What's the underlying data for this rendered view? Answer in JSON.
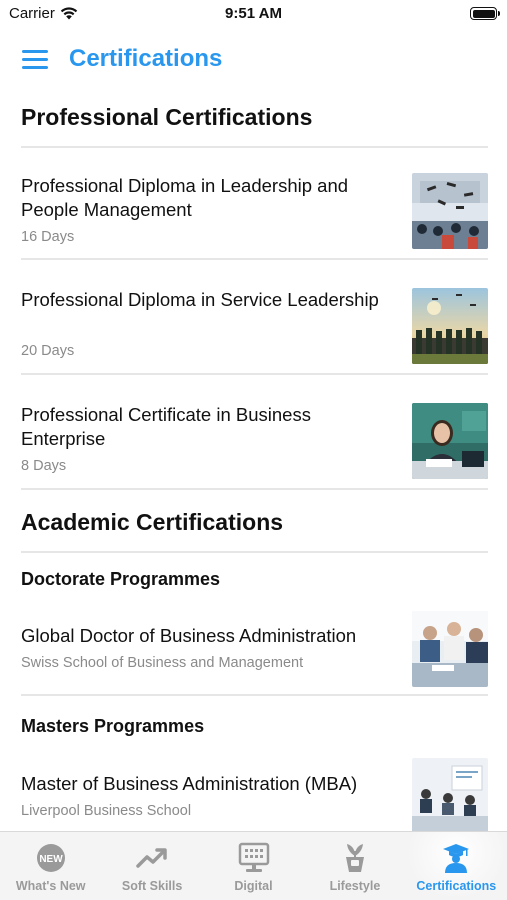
{
  "status_bar": {
    "carrier": "Carrier",
    "time": "9:51 AM"
  },
  "nav": {
    "title": "Certifications"
  },
  "professional": {
    "title": "Professional Certifications",
    "items": [
      {
        "title": "Professional Diploma in Leadership and People Management",
        "subtitle": "16 Days",
        "image": "graduation-cap-toss-photo"
      },
      {
        "title": "Professional Diploma in Service Leadership",
        "subtitle": "20 Days",
        "image": "graduates-sunset-photo"
      },
      {
        "title": "Professional Certificate in Business Enterprise",
        "subtitle": "8 Days",
        "image": "businesswoman-desk-photo"
      }
    ]
  },
  "academic": {
    "title": "Academic Certifications",
    "doctorate": {
      "title": "Doctorate Programmes",
      "items": [
        {
          "title": "Global Doctor of Business Administration",
          "subtitle": "Swiss School of Business and Management",
          "image": "business-meeting-photo"
        }
      ]
    },
    "masters": {
      "title": "Masters Programmes",
      "items": [
        {
          "title": "Master of Business Administration (MBA)",
          "subtitle": "Liverpool Business School",
          "image": "conference-room-photo"
        }
      ]
    }
  },
  "tabs": [
    {
      "label": "What's New",
      "icon": "new-badge-icon",
      "active": false
    },
    {
      "label": "Soft Skills",
      "icon": "trending-up-icon",
      "active": false
    },
    {
      "label": "Digital",
      "icon": "digital-board-icon",
      "active": false
    },
    {
      "label": "Lifestyle",
      "icon": "plant-pot-icon",
      "active": false
    },
    {
      "label": "Certifications",
      "icon": "graduate-person-icon",
      "active": true
    }
  ],
  "colors": {
    "accent": "#2A97EE",
    "inactive_tab": "#9a9a9a",
    "subtitle": "#8a8a8a"
  }
}
